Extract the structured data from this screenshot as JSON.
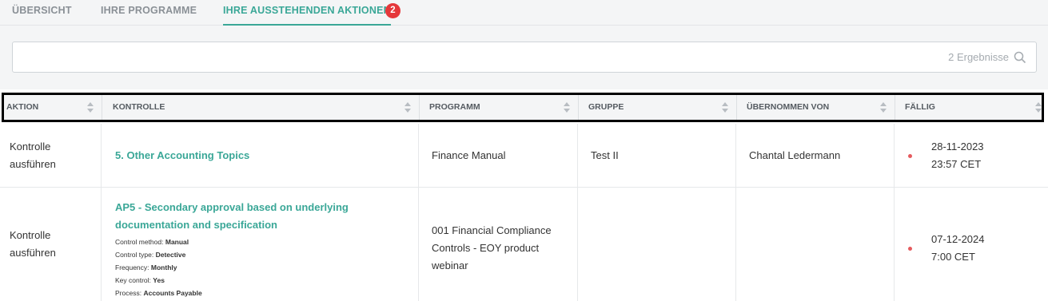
{
  "tabs": [
    {
      "label": "ÜBERSICHT"
    },
    {
      "label": "IHRE PROGRAMME"
    },
    {
      "label": "IHRE AUSSTEHENDEN AKTIONEN",
      "badge": "2",
      "active": true
    }
  ],
  "search": {
    "value": "",
    "results_text": "2 Ergebnisse",
    "icon": "search-icon"
  },
  "table": {
    "columns": [
      "AKTION",
      "KONTROLLE",
      "PROGRAMM",
      "GRUPPE",
      "ÜBERNOMMEN VON",
      "FÄLLIG"
    ],
    "rows": [
      {
        "aktion_line1": "Kontrolle",
        "aktion_line2": "ausführen",
        "kontrolle": "5. Other Accounting Topics",
        "programm": "Finance Manual",
        "gruppe": "Test II",
        "uebernommen_von": "Chantal Ledermann",
        "faellig_date": "28-11-2023",
        "faellig_time": "23:57 CET"
      },
      {
        "aktion_line1": "Kontrolle",
        "aktion_line2": "ausführen",
        "kontrolle_line1": "AP5 - Secondary approval based on underlying",
        "kontrolle_line2": "documentation and specification",
        "details": [
          {
            "label": "Control method:",
            "value": "Manual"
          },
          {
            "label": "Control type:",
            "value": "Detective"
          },
          {
            "label": "Frequency:",
            "value": "Monthly"
          },
          {
            "label": "Key control:",
            "value": "Yes"
          },
          {
            "label": "Process:",
            "value": "Accounts Payable"
          }
        ],
        "programm_line1": "001 Financial Compliance",
        "programm_line2": "Controls - EOY product",
        "programm_line3": "webinar",
        "gruppe": "",
        "uebernommen_von": "",
        "faellig_date": "07-12-2024",
        "faellig_time": "7:00 CET"
      }
    ]
  },
  "colors": {
    "accent": "#3aa797",
    "badge": "#e5383b",
    "due_dot": "#e55a5e"
  }
}
